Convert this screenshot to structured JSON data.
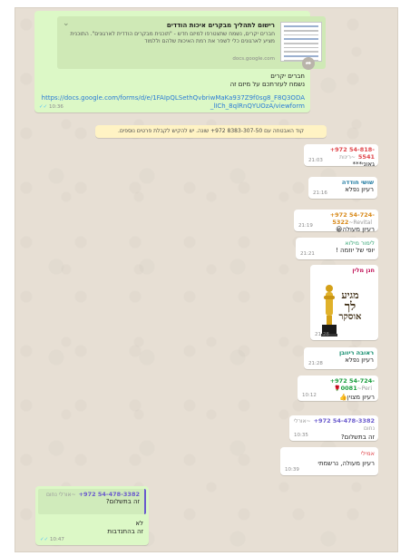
{
  "top_message": {
    "preview_title": "רישום לתהליך מבקרים איכות הודדים",
    "preview_desc": "חברים יקרים, נשמח שתצטרפו למיזם חדש - \"תוכנית מבקרים הודדית לארגונים\". התוכנית מציע לארגונים כלי לשפר את רמת האיכות שלהם וללמוד",
    "preview_domain": "docs.google.com",
    "line1": "חברים יקרים",
    "line2": "נשמח לעזרתכם על מיזם זה",
    "link": "https://docs.google.com/forms/d/e/1FAIpQLSethQvbriwMaKa937Z9f0sg8_F8Q3ODA_lICh_8qlRnQYUOzA/viewform",
    "time": "10:36"
  },
  "system_notice": "קוד האבטחה עם 8383-307-50 972+ שונה. יש להקיש לקבלת פרטים נוספים.",
  "messages": [
    {
      "sender": "+972 54-818-5541",
      "alias": "~רינות",
      "text": "גאוני***",
      "time": "21:03",
      "color": "#e0474c"
    },
    {
      "sender": "שושי חודדה",
      "text": "רעיון נפלא",
      "time": "21:16",
      "color": "#1f7aa0"
    },
    {
      "sender": "+972 54-724-5322",
      "alias": "~Revital",
      "text": "רעיון מעולה😀",
      "time": "21:19",
      "color": "#d88a1b"
    },
    {
      "sender": "לימור מילוא",
      "text": "יופי של יוזמה !",
      "time": "21:21",
      "color": "#3aa776"
    },
    {
      "sender": "חנן מלין",
      "time": "21:28",
      "color": "#c2185b"
    },
    {
      "sender": "ראובה ריוובן",
      "text": "רעיון נפלא",
      "time": "21:28",
      "color": "#0e8a6a"
    },
    {
      "sender": "+972 54-724-0081",
      "alias": "~Peri🌹",
      "text": "רעיון מצוין👍",
      "time": "10:12",
      "color": "#1b9e3e"
    },
    {
      "sender": "+972 54-478-3382",
      "alias": "~אורלי נחום",
      "text": "זה בתשלום?",
      "time": "10:35",
      "color": "#6a5acd"
    },
    {
      "sender": "אמילי",
      "text": "רעיון מעולה, נרשמתי",
      "time": "10:39",
      "color": "#e0474c"
    }
  ],
  "sticker": {
    "line1": "מגיע",
    "line2": "לך",
    "line3": "אוסקר"
  },
  "reply": {
    "quote_sender": "+972 54-478-3382",
    "quote_alias": "~אורלי נחום",
    "quote_text": "זה בתשלום?",
    "line1": "לא",
    "line2": "זה בהתנדבות",
    "time": "10:47"
  },
  "icons": {
    "share": "share-icon",
    "chevron": "chevron-down-icon",
    "read_receipt": "double-check-icon"
  }
}
